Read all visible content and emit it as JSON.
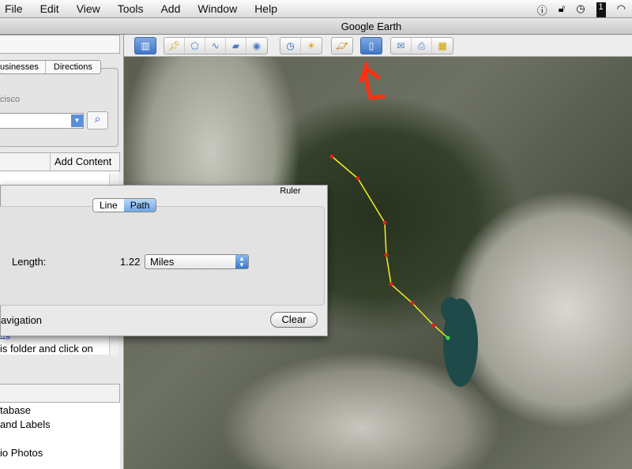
{
  "menubar": {
    "items": [
      "File",
      "Edit",
      "View",
      "Tools",
      "Add",
      "Window",
      "Help"
    ],
    "status_icons": [
      "alert-icon",
      "lock-icon",
      "time-machine-icon",
      "spaces-icon",
      "wifi-icon"
    ]
  },
  "window": {
    "title": "Google Earth"
  },
  "toolbar": {
    "buttons": [
      "sidebar-toggle",
      "add-placemark",
      "add-polygon",
      "add-path",
      "add-image-overlay",
      "record-tour",
      "historical-imagery",
      "sunlight",
      "switch-planet",
      "ruler",
      "email",
      "print",
      "view-in-google-maps"
    ],
    "active": "ruler"
  },
  "sidebar": {
    "tabs": [
      "usinesses",
      "Directions"
    ],
    "search_hint": "cisco",
    "add_content": "Add Content",
    "link_fragment": "ng",
    "hint_text": "is folder and click on",
    "layers": [
      "tabase",
      "and Labels",
      "io Photos"
    ]
  },
  "ruler": {
    "title": "Ruler",
    "tabs": [
      "Line",
      "Path"
    ],
    "active_tab": "Path",
    "length_label": "Length:",
    "length_value": "1.22",
    "unit": "Miles",
    "navigation_label": "avigation",
    "clear": "Clear"
  },
  "path_color": "#f0f020",
  "annotation_color": "#ff3010"
}
